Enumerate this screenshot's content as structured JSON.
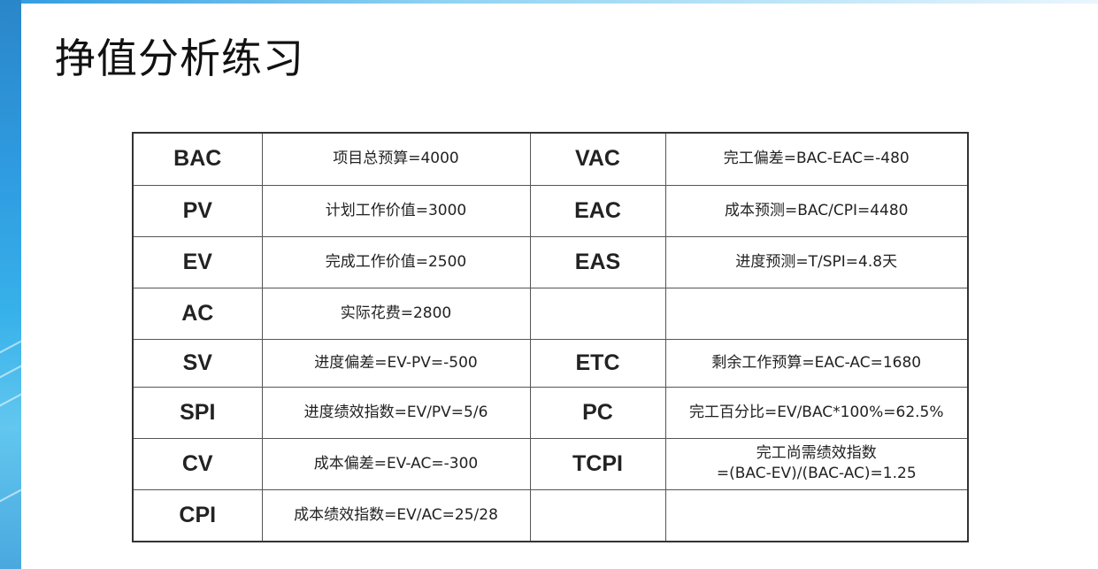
{
  "title": "挣值分析练习",
  "rows": [
    {
      "left_abbr": "BAC",
      "left_def": "项目总预算=4000",
      "right_abbr": "VAC",
      "right_def": "完工偏差=BAC-EAC=-480"
    },
    {
      "left_abbr": "PV",
      "left_def": "计划工作价值=3000",
      "right_abbr": "EAC",
      "right_def": "成本预测=BAC/CPI=4480"
    },
    {
      "left_abbr": "EV",
      "left_def": "完成工作价值=2500",
      "right_abbr": "EAS",
      "right_def": "进度预测=T/SPI=4.8天"
    },
    {
      "left_abbr": "AC",
      "left_def": "实际花费=2800",
      "right_abbr": "",
      "right_def": ""
    },
    {
      "left_abbr": "SV",
      "left_def": "进度偏差=EV-PV=-500",
      "right_abbr": "ETC",
      "right_def": "剩余工作预算=EAC-AC=1680"
    },
    {
      "left_abbr": "SPI",
      "left_def": "进度绩效指数=EV/PV=5/6",
      "right_abbr": "PC",
      "right_def": "完工百分比=EV/BAC*100%=62.5%"
    },
    {
      "left_abbr": "CV",
      "left_def": "成本偏差=EV-AC=-300",
      "right_abbr": "TCPI",
      "right_def_line1": "完工尚需绩效指数",
      "right_def_line2": "=(BAC-EV)/(BAC-AC)=1.25"
    },
    {
      "left_abbr": "CPI",
      "left_def": "成本绩效指数=EV/AC=25/28",
      "right_abbr": "",
      "right_def": ""
    }
  ],
  "colors": {
    "abbr_text": "#0f4d3a",
    "accent_strip": "#2f9be0",
    "border": "#333333"
  }
}
